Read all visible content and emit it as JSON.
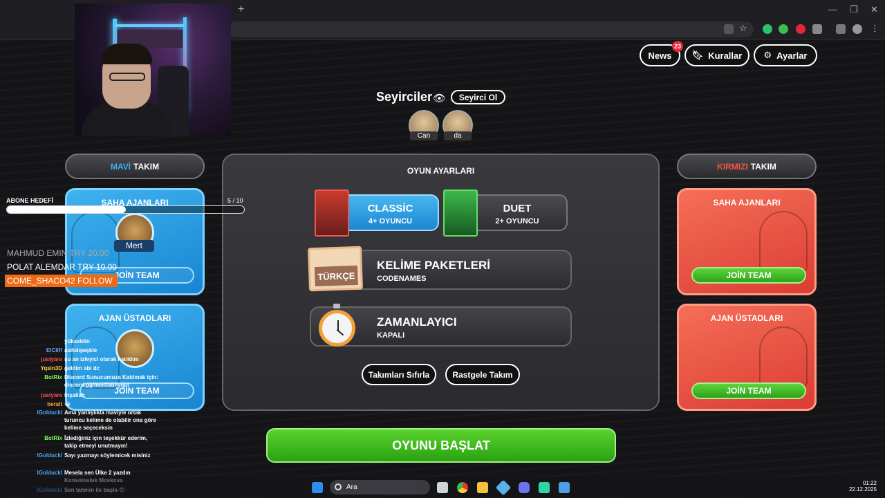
{
  "header": {
    "news_label": "News",
    "news_badge": "23",
    "rules_label": "Kurallar",
    "settings_label": "Ayarlar"
  },
  "spectators": {
    "title": "Seyirciler",
    "button": "Seyirci Ol",
    "names": [
      "Can",
      "da"
    ]
  },
  "blue_team": {
    "prefix": "MAVİ",
    "suffix": "TAKIM",
    "field_agents_title": "SAHA AJANLARI",
    "field_agent_player": "Mert",
    "spymasters_title": "AJAN ÜSTADLARI",
    "join_label": "JOİN TEAM",
    "accent": "#3fb2ef"
  },
  "red_team": {
    "prefix": "KIRMIZI",
    "suffix": "TAKIM",
    "field_agents_title": "SAHA AJANLARI",
    "spymasters_title": "AJAN ÜSTADLARI",
    "join_label": "JOİN TEAM",
    "accent": "#f0583f"
  },
  "game_settings": {
    "title": "OYUN AYARLARI",
    "mode_classic": {
      "title": "CLASSİC",
      "subtitle": "4+ OYUNCU",
      "selected": true
    },
    "mode_duet": {
      "title": "DUET",
      "subtitle": "2+ OYUNCU",
      "selected": false
    },
    "word_packs": {
      "title": "KELİME PAKETLERİ",
      "subtitle": "CODENAMES",
      "badge": "TÜRKÇE"
    },
    "timer": {
      "title": "ZAMANLAYICI",
      "subtitle": "KAPALI"
    },
    "reset_teams": "Takımları Sıfırla",
    "random_teams": "Rastgele Takım"
  },
  "start_button": "OYUNU BAŞLAT",
  "stream_overlay": {
    "goal_label": "ABONE HEDEFİ",
    "goal_count": "5 / 10",
    "goal_progress": 0.5,
    "donations": [
      "MAHMUD EMIN TRY 20.00",
      "POLAT ALEMDAR TRY 10.00"
    ],
    "follow_alert": "COME_SHACO42  FOLLOW"
  },
  "chat": [
    {
      "name": "",
      "msg": "yükseldin",
      "color": "#fff"
    },
    {
      "name": "ElCliff",
      "msg": "asikdqwşkle",
      "color": "#6aa7ff"
    },
    {
      "name": "justyare",
      "msg": "şu an izleyici olarak katıldım",
      "color": "#ff4b4b"
    },
    {
      "name": "Yqsin3D",
      "msg": "geldim abi dc",
      "color": "#ffd33a"
    },
    {
      "name": "BotRix",
      "msg": "Discord Sunucumuza Katılmak için: discord.gg/mertfatihyiğit",
      "color": "#7cff5a"
    },
    {
      "name": "justyare",
      "msg": "inşallah",
      "color": "#ff4b4b"
    },
    {
      "name": "beralt",
      "msg": "😂",
      "color": "#ffa53a"
    },
    {
      "name": "lGolduckl",
      "msg": "Ama yanlışlıkla maviyle ortak turuncu kelime de olabilir ona göre kelime seçeceksin",
      "color": "#4aa8ff"
    },
    {
      "name": "BotRix",
      "msg": "İzlediğiniz için teşekkür ederim, takip etmeyi unutmayın!",
      "color": "#7cff5a"
    },
    {
      "name": "lGolduckl",
      "msg": "Sayı yazmayı söylemicek misiniz",
      "color": "#4aa8ff"
    },
    {
      "name": "lGolduckl",
      "msg": "Mesela sen Ülke 2 yazdın Konsolosluk Moskova",
      "color": "#4aa8ff"
    },
    {
      "name": "lGolduckl",
      "msg": "Sen tahmin ile başla 😊",
      "color": "#4aa8ff"
    }
  ],
  "taskbar": {
    "search_placeholder": "Ara",
    "time": "01:22",
    "date": "22.12.2025"
  }
}
